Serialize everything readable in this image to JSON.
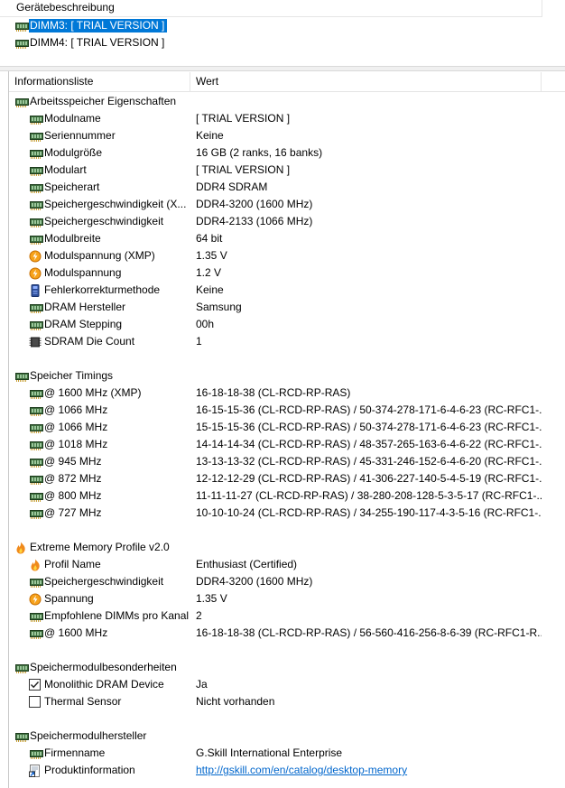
{
  "top": {
    "header": "Gerätebeschreibung",
    "devices": [
      {
        "label": "DIMM3: [ TRIAL VERSION ]",
        "selected": true
      },
      {
        "label": "DIMM4: [ TRIAL VERSION ]",
        "selected": false
      }
    ]
  },
  "list": {
    "col_name": "Informationsliste",
    "col_value": "Wert",
    "rows": [
      {
        "type": "section",
        "name": "Arbeitsspeicher Eigenschaften",
        "icon": "ram-icon"
      },
      {
        "type": "item",
        "name": "Modulname",
        "value": "[ TRIAL VERSION ]",
        "icon": "ram-icon"
      },
      {
        "type": "item",
        "name": "Seriennummer",
        "value": "Keine",
        "icon": "ram-icon"
      },
      {
        "type": "item",
        "name": "Modulgröße",
        "value": "16 GB (2 ranks, 16 banks)",
        "icon": "ram-icon"
      },
      {
        "type": "item",
        "name": "Modulart",
        "value": "[ TRIAL VERSION ]",
        "icon": "ram-icon"
      },
      {
        "type": "item",
        "name": "Speicherart",
        "value": "DDR4 SDRAM",
        "icon": "ram-icon"
      },
      {
        "type": "item",
        "name": "Speichergeschwindigkeit (X...",
        "value": "DDR4-3200 (1600 MHz)",
        "icon": "ram-icon"
      },
      {
        "type": "item",
        "name": "Speichergeschwindigkeit",
        "value": "DDR4-2133 (1066 MHz)",
        "icon": "ram-icon"
      },
      {
        "type": "item",
        "name": "Modulbreite",
        "value": "64 bit",
        "icon": "ram-icon"
      },
      {
        "type": "item",
        "name": "Modulspannung (XMP)",
        "value": "1.35 V",
        "icon": "voltage-icon"
      },
      {
        "type": "item",
        "name": "Modulspannung",
        "value": "1.2 V",
        "icon": "voltage-icon"
      },
      {
        "type": "item",
        "name": "Fehlerkorrekturmethode",
        "value": "Keine",
        "icon": "ecc-icon"
      },
      {
        "type": "item",
        "name": "DRAM Hersteller",
        "value": "Samsung",
        "icon": "ram-icon"
      },
      {
        "type": "item",
        "name": "DRAM Stepping",
        "value": "00h",
        "icon": "ram-icon"
      },
      {
        "type": "item",
        "name": "SDRAM Die Count",
        "value": "1",
        "icon": "chip-icon"
      },
      {
        "type": "blank"
      },
      {
        "type": "section",
        "name": "Speicher Timings",
        "icon": "ram-icon"
      },
      {
        "type": "item",
        "name": "@ 1600 MHz (XMP)",
        "value": "16-18-18-38  (CL-RCD-RP-RAS)",
        "icon": "ram-icon"
      },
      {
        "type": "item",
        "name": "@ 1066 MHz",
        "value": "16-15-15-36  (CL-RCD-RP-RAS) / 50-374-278-171-6-4-6-23  (RC-RFC1-...",
        "icon": "ram-icon"
      },
      {
        "type": "item",
        "name": "@ 1066 MHz",
        "value": "15-15-15-36  (CL-RCD-RP-RAS) / 50-374-278-171-6-4-6-23  (RC-RFC1-...",
        "icon": "ram-icon"
      },
      {
        "type": "item",
        "name": "@ 1018 MHz",
        "value": "14-14-14-34  (CL-RCD-RP-RAS) / 48-357-265-163-6-4-6-22  (RC-RFC1-...",
        "icon": "ram-icon"
      },
      {
        "type": "item",
        "name": "@ 945 MHz",
        "value": "13-13-13-32  (CL-RCD-RP-RAS) / 45-331-246-152-6-4-6-20  (RC-RFC1-...",
        "icon": "ram-icon"
      },
      {
        "type": "item",
        "name": "@ 872 MHz",
        "value": "12-12-12-29  (CL-RCD-RP-RAS) / 41-306-227-140-5-4-5-19  (RC-RFC1-...",
        "icon": "ram-icon"
      },
      {
        "type": "item",
        "name": "@ 800 MHz",
        "value": "11-11-11-27  (CL-RCD-RP-RAS) / 38-280-208-128-5-3-5-17  (RC-RFC1-...",
        "icon": "ram-icon"
      },
      {
        "type": "item",
        "name": "@ 727 MHz",
        "value": "10-10-10-24  (CL-RCD-RP-RAS) / 34-255-190-117-4-3-5-16  (RC-RFC1-...",
        "icon": "ram-icon"
      },
      {
        "type": "blank"
      },
      {
        "type": "section",
        "name": "Extreme Memory Profile v2.0",
        "icon": "flame-icon"
      },
      {
        "type": "item",
        "name": "Profil Name",
        "value": "Enthusiast (Certified)",
        "icon": "flame-icon"
      },
      {
        "type": "item",
        "name": "Speichergeschwindigkeit",
        "value": "DDR4-3200 (1600 MHz)",
        "icon": "ram-icon"
      },
      {
        "type": "item",
        "name": "Spannung",
        "value": "1.35 V",
        "icon": "voltage-icon"
      },
      {
        "type": "item",
        "name": "Empfohlene DIMMs pro Kanal",
        "value": "2",
        "icon": "ram-icon"
      },
      {
        "type": "item",
        "name": "@ 1600 MHz",
        "value": "16-18-18-38  (CL-RCD-RP-RAS) / 56-560-416-256-8-6-39  (RC-RFC1-R...",
        "icon": "ram-icon"
      },
      {
        "type": "blank"
      },
      {
        "type": "section",
        "name": "Speichermodulbesonderheiten",
        "icon": "ram-icon"
      },
      {
        "type": "item",
        "name": "Monolithic DRAM Device",
        "value": "Ja",
        "icon": "checkbox-checked-icon"
      },
      {
        "type": "item",
        "name": "Thermal Sensor",
        "value": "Nicht vorhanden",
        "icon": "checkbox-empty-icon"
      },
      {
        "type": "blank"
      },
      {
        "type": "section",
        "name": "Speichermodulhersteller",
        "icon": "ram-icon"
      },
      {
        "type": "item",
        "name": "Firmenname",
        "value": "G.Skill International Enterprise",
        "icon": "ram-icon"
      },
      {
        "type": "item",
        "name": "Produktinformation",
        "value": "http://gskill.com/en/catalog/desktop-memory",
        "icon": "link-icon",
        "link": true
      }
    ]
  }
}
